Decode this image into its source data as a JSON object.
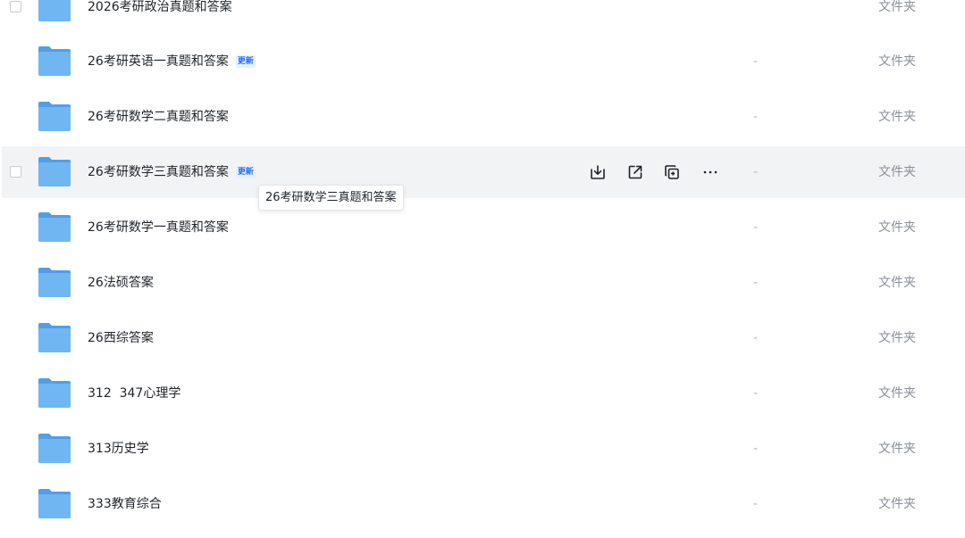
{
  "files": [
    {
      "name": "2026考研政治真题和答案",
      "badge": "",
      "size": "",
      "type": "文件夹"
    },
    {
      "name": "26考研英语一真题和答案",
      "badge": "更新",
      "size": "-",
      "type": "文件夹"
    },
    {
      "name": "26考研数学二真题和答案",
      "badge": "",
      "size": "-",
      "type": "文件夹"
    },
    {
      "name": "26考研数学三真题和答案",
      "badge": "更新",
      "size": "-",
      "type": "文件夹"
    },
    {
      "name": "26考研数学一真题和答案",
      "badge": "",
      "size": "-",
      "type": "文件夹"
    },
    {
      "name": "26法硕答案",
      "badge": "",
      "size": "-",
      "type": "文件夹"
    },
    {
      "name": "26西综答案",
      "badge": "",
      "size": "-",
      "type": "文件夹"
    },
    {
      "name": "312  347心理学",
      "badge": "",
      "size": "-",
      "type": "文件夹"
    },
    {
      "name": "313历史学",
      "badge": "",
      "size": "-",
      "type": "文件夹"
    },
    {
      "name": "333教育综合",
      "badge": "",
      "size": "-",
      "type": "文件夹"
    }
  ],
  "tooltip": {
    "text": "26考研数学三真题和答案"
  },
  "row_actions": {
    "download_icon": "download-icon",
    "share_icon": "share-icon",
    "copy_icon": "copy-icon",
    "more_icon": "more-icon",
    "more_label": "···"
  },
  "colors": {
    "folder": "#5aaaf0",
    "badge": "#1a6dff",
    "hover_row": "#f2f3f5"
  }
}
